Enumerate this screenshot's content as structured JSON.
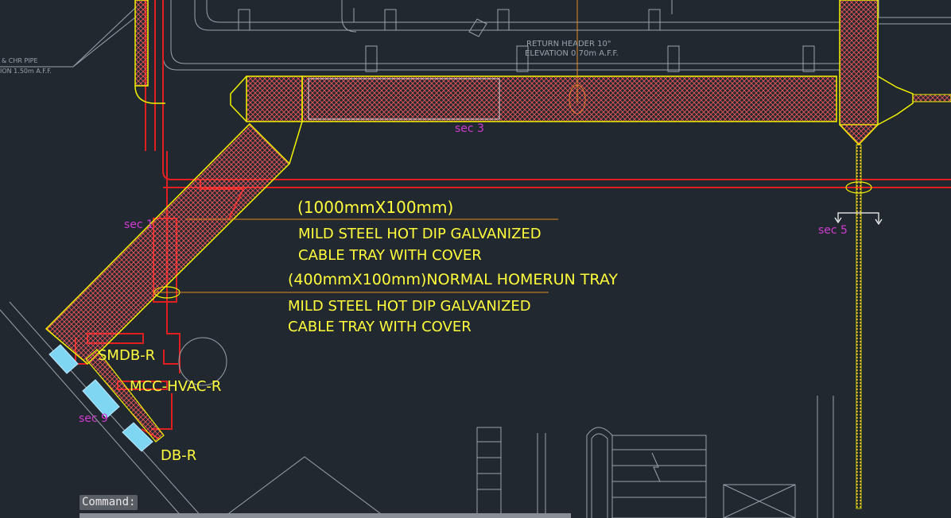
{
  "drawing": {
    "colors": {
      "background": "#212830",
      "tray_outline": "#f2f200",
      "tray_hatch": "#ff5a5a",
      "conduit": "#e02020",
      "leader": "#e58a1e",
      "text": "#ffff3c",
      "section_label": "#d13ad1",
      "background_linework": "#9aa2aa",
      "panel_fill": "#7fd6f2",
      "dim_white": "#ffffff"
    },
    "annotations": {
      "tray_1000_size": "(1000mmX100mm)",
      "tray_1000_desc_1": "MILD STEEL HOT DIP GALVANIZED",
      "tray_1000_desc_2": "CABLE TRAY WITH COVER",
      "tray_400_size": "(400mmX100mm)NORMAL HOMERUN TRAY",
      "tray_400_desc_1": "MILD STEEL HOT DIP GALVANIZED",
      "tray_400_desc_2": "CABLE TRAY WITH COVER"
    },
    "panels": {
      "smdb": "SMDB-R",
      "mcc": "MCC-HVAC-R",
      "db": "DB-R"
    },
    "sections": {
      "sec3": "sec 3",
      "sec1": "sec 1",
      "sec5": "sec 5",
      "sec9": "sec 9"
    },
    "pipe_notes": {
      "return_header": "RETURN HEADER 10\"",
      "elevation": "ELEVATION  0.70m A.F.F.",
      "chr_pipe": "& CHR PIPE",
      "chr_elevation": "ION 1.50m A.F.F."
    }
  },
  "command": {
    "label": "Command:"
  }
}
